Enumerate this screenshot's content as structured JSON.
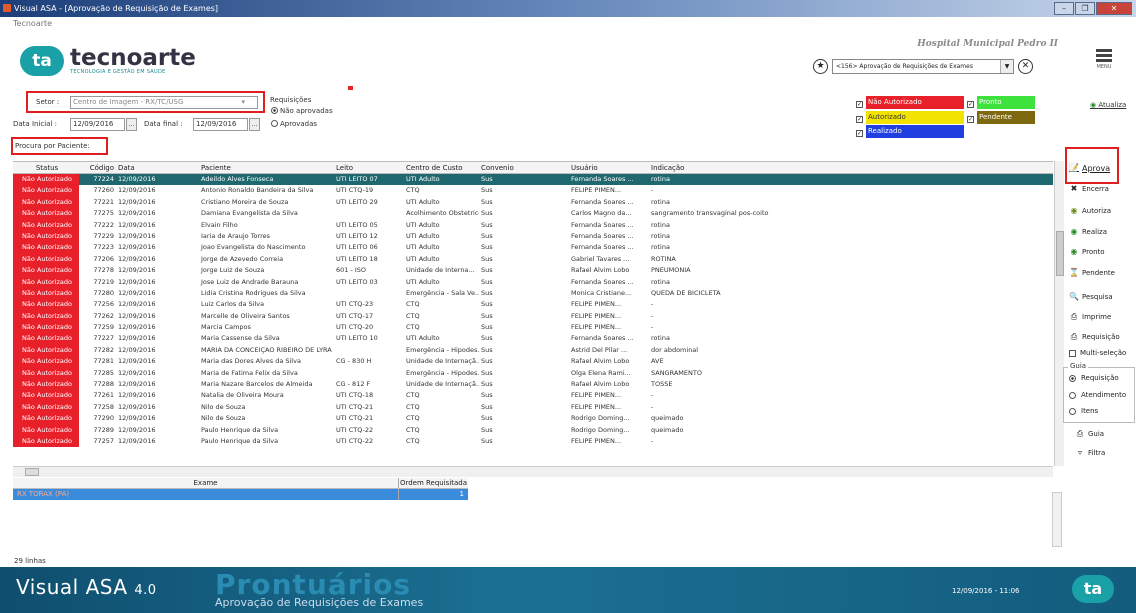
{
  "window": {
    "title": "Visual ASA - [Aprovação de Requisição de Exames]",
    "app_tag": "Tecnoarte"
  },
  "logo": {
    "mark": "ta",
    "name": "tecnoarte",
    "sub": "TECNOLOGIA E GESTÃO EM SAÚDE"
  },
  "header": {
    "hospital": "Hospital Municipal Pedro II",
    "module": "<156> Aprovação de Requisições de Exames",
    "menu": "MENU"
  },
  "filters": {
    "setor_label": "Setor :",
    "setor_value": "Centro de Imagem - RX/TC/USG",
    "data_inicial_label": "Data Inicial :",
    "data_inicial": "12/09/2016",
    "data_final_label": "Data final :",
    "data_final": "12/09/2016",
    "req_label": "Requisições",
    "opt1": "Não aprovadas",
    "opt2": "Aprovadas",
    "search_label": "Procura por Paciente:"
  },
  "legend": {
    "nao_autorizado": "Não Autorizado",
    "pronto": "Pronto",
    "autorizado": "Autorizado",
    "pendente": "Pendente",
    "realizado": "Realizado",
    "atualiza": "Atualiza"
  },
  "colors": {
    "nao_autorizado": "#e8202a",
    "pronto": "#3de23d",
    "autorizado": "#f2e400",
    "pendente": "#7d6a10",
    "realizado": "#1f3fe0",
    "selected": "#1f6870"
  },
  "grid": {
    "headers": [
      "Status",
      "Código",
      "Data",
      "Paciente",
      "Leito",
      "Centro de Custo",
      "Convenio",
      "Usuário",
      "Indicação"
    ],
    "rows": [
      [
        "Não Autorizado",
        "77224",
        "12/09/2016",
        "Adeildo Alves Fonseca",
        "UTI LEITO 07",
        "UTI Adulto",
        "Sus",
        "Fernanda Soares ...",
        "rotina"
      ],
      [
        "Não Autorizado",
        "77260",
        "12/09/2016",
        "Antonio Ronaldo Bandeira da Silva",
        "UTI CTQ-19",
        "CTQ",
        "Sus",
        "FELIPE PIMEN...",
        "-"
      ],
      [
        "Não Autorizado",
        "77221",
        "12/09/2016",
        "Cristiano Moreira de Souza",
        "UTI LEITO 29",
        "UTI Adulto",
        "Sus",
        "Fernanda Soares ...",
        "rotina"
      ],
      [
        "Não Autorizado",
        "77275",
        "12/09/2016",
        "Damiana Evangelista da Silva",
        "",
        "Acolhimento Obstetrico",
        "Sus",
        "Carlos Magno da...",
        "sangramento transvaginal pos-coito"
      ],
      [
        "Não Autorizado",
        "77222",
        "12/09/2016",
        "Elvain Filho",
        "UTI LEITO 05",
        "UTI Adulto",
        "Sus",
        "Fernanda Soares ...",
        "rotina"
      ],
      [
        "Não Autorizado",
        "77229",
        "12/09/2016",
        "Iaria de Araujo Torres",
        "UTI LEITO 12",
        "UTI Adulto",
        "Sus",
        "Fernanda Soares ...",
        "rotina"
      ],
      [
        "Não Autorizado",
        "77223",
        "12/09/2016",
        "Joao Evangelista do Nascimento",
        "UTI LEITO 06",
        "UTI Adulto",
        "Sus",
        "Fernanda Soares ...",
        "rotina"
      ],
      [
        "Não Autorizado",
        "77206",
        "12/09/2016",
        "Jorge de Azevedo Correia",
        "UTI LEITO 18",
        "UTI Adulto",
        "Sus",
        "Gabriel Tavares ...",
        "ROTINA"
      ],
      [
        "Não Autorizado",
        "77278",
        "12/09/2016",
        "Jorge Luiz de Souza",
        "601 - ISO",
        "Unidade de Interna...",
        "Sus",
        "Rafael Alvim Lobo",
        "PNEUMONIA"
      ],
      [
        "Não Autorizado",
        "77219",
        "12/09/2016",
        "Jose Luiz de Andrade Barauna",
        "UTI LEITO 03",
        "UTI Adulto",
        "Sus",
        "Fernanda Soares ...",
        "rotina"
      ],
      [
        "Não Autorizado",
        "77280",
        "12/09/2016",
        "Lidia Cristina Rodrigues da Silva",
        "",
        "Emergência - Sala Ve...",
        "Sus",
        "Monica Cristiane...",
        "QUEDA DE BICICLETA"
      ],
      [
        "Não Autorizado",
        "77256",
        "12/09/2016",
        "Luiz Carlos da Silva",
        "UTI CTQ-23",
        "CTQ",
        "Sus",
        "FELIPE PIMEN...",
        "-"
      ],
      [
        "Não Autorizado",
        "77262",
        "12/09/2016",
        "Marcelle de Oliveira Santos",
        "UTI CTQ-17",
        "CTQ",
        "Sus",
        "FELIPE PIMEN...",
        "-"
      ],
      [
        "Não Autorizado",
        "77259",
        "12/09/2016",
        "Marcia Campos",
        "UTI CTQ-20",
        "CTQ",
        "Sus",
        "FELIPE PIMEN...",
        "-"
      ],
      [
        "Não Autorizado",
        "77227",
        "12/09/2016",
        "Maria Cassense da Silva",
        "UTI LEITO 10",
        "UTI Adulto",
        "Sus",
        "Fernanda Soares ...",
        "rotina"
      ],
      [
        "Não Autorizado",
        "77282",
        "12/09/2016",
        "MARIA DA CONCEIÇAO RIBEIRO DE LYRA",
        "",
        "Emergência - Hipodes...",
        "Sus",
        "Astrid Del Pilar ...",
        "dor abdominal"
      ],
      [
        "Não Autorizado",
        "77281",
        "12/09/2016",
        "Maria das Dores Alves da Silva",
        "CG - 830 H",
        "Unidade de Internaçã...",
        "Sus",
        "Rafael Alvim Lobo",
        "AVE"
      ],
      [
        "Não Autorizado",
        "77285",
        "12/09/2016",
        "Maria de Fatima Felix da Silva",
        "",
        "Emergência - Hipodes...",
        "Sus",
        "Olga Elena Rami...",
        "SANGRAMENTO"
      ],
      [
        "Não Autorizado",
        "77288",
        "12/09/2016",
        "Maria Nazare Barcelos de Almeida",
        "CG - 812 F",
        "Unidade de Internaçã...",
        "Sus",
        "Rafael Alvim Lobo",
        "TOSSE"
      ],
      [
        "Não Autorizado",
        "77261",
        "12/09/2016",
        "Natalia de Oliveira Moura",
        "UTI CTQ-18",
        "CTQ",
        "Sus",
        "FELIPE PIMEN...",
        "-"
      ],
      [
        "Não Autorizado",
        "77258",
        "12/09/2016",
        "Nilo de Souza",
        "UTI CTQ-21",
        "CTQ",
        "Sus",
        "FELIPE PIMEN...",
        "-"
      ],
      [
        "Não Autorizado",
        "77290",
        "12/09/2016",
        "Nilo de Souza",
        "UTI CTQ-21",
        "CTQ",
        "Sus",
        "Rodrigo Doming...",
        "queimado"
      ],
      [
        "Não Autorizado",
        "77289",
        "12/09/2016",
        "Paulo Henrique da Silva",
        "UTI CTQ-22",
        "CTQ",
        "Sus",
        "Rodrigo Doming...",
        "queimado"
      ],
      [
        "Não Autorizado",
        "77257",
        "12/09/2016",
        "Paulo Henrique da Silva",
        "UTI CTQ-22",
        "CTQ",
        "Sus",
        "FELIPE PIMEN...",
        "-"
      ]
    ]
  },
  "subgrid": {
    "headers": [
      "Exame",
      "Ordem Requisitada"
    ],
    "rows": [
      [
        "RX TORAX (PA)",
        "1"
      ]
    ]
  },
  "status": {
    "count": "29 linhas"
  },
  "actions": {
    "aprova": "Aprova",
    "encerra": "Encerra",
    "autoriza": "Autoriza",
    "realiza": "Realiza",
    "pronto": "Pronto",
    "pendente": "Pendente",
    "pesquisa": "Pesquisa",
    "imprime": "Imprime",
    "requisicao": "Requisição",
    "multi": "Multi-seleção",
    "guia_group": "Guia",
    "guia_req": "Requisição",
    "guia_atend": "Atendimento",
    "guia_itens": "Itens",
    "guia": "Guia",
    "filtra": "Filtra"
  },
  "footer": {
    "product": "Visual ASA",
    "version": "4.0",
    "module_big": "Prontuários",
    "module_sub": "Aprovação de Requisições de Exames",
    "datetime": "12/09/2016 - 11:06",
    "ta": "ta"
  }
}
